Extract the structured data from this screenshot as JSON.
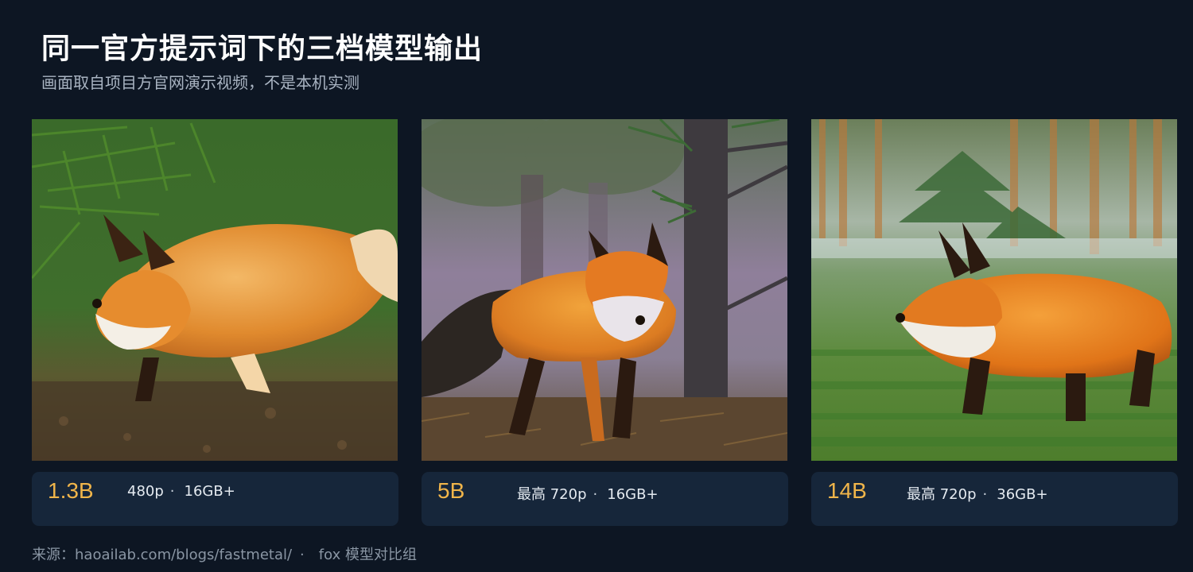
{
  "header": {
    "title": "同一官方提示词下的三档模型输出",
    "subtitle": "画面取自项目方官网演示视频，不是本机实测"
  },
  "cards": [
    {
      "model": "1.3B",
      "resolution": "480p",
      "sep": "·",
      "vram": "16GB+"
    },
    {
      "model": "5B",
      "resolution": "最高 720p",
      "sep": "·",
      "vram": "16GB+"
    },
    {
      "model": "14B",
      "resolution": "最高 720p",
      "sep": "·",
      "vram": "36GB+"
    }
  ],
  "footer": {
    "source": "来源：haoailab.com/blogs/fastmetal/",
    "sep": "·",
    "group": "fox 模型对比组"
  },
  "colors": {
    "background": "#0d1623",
    "caption_bg": "#16263a",
    "accent": "#f0b54a"
  }
}
